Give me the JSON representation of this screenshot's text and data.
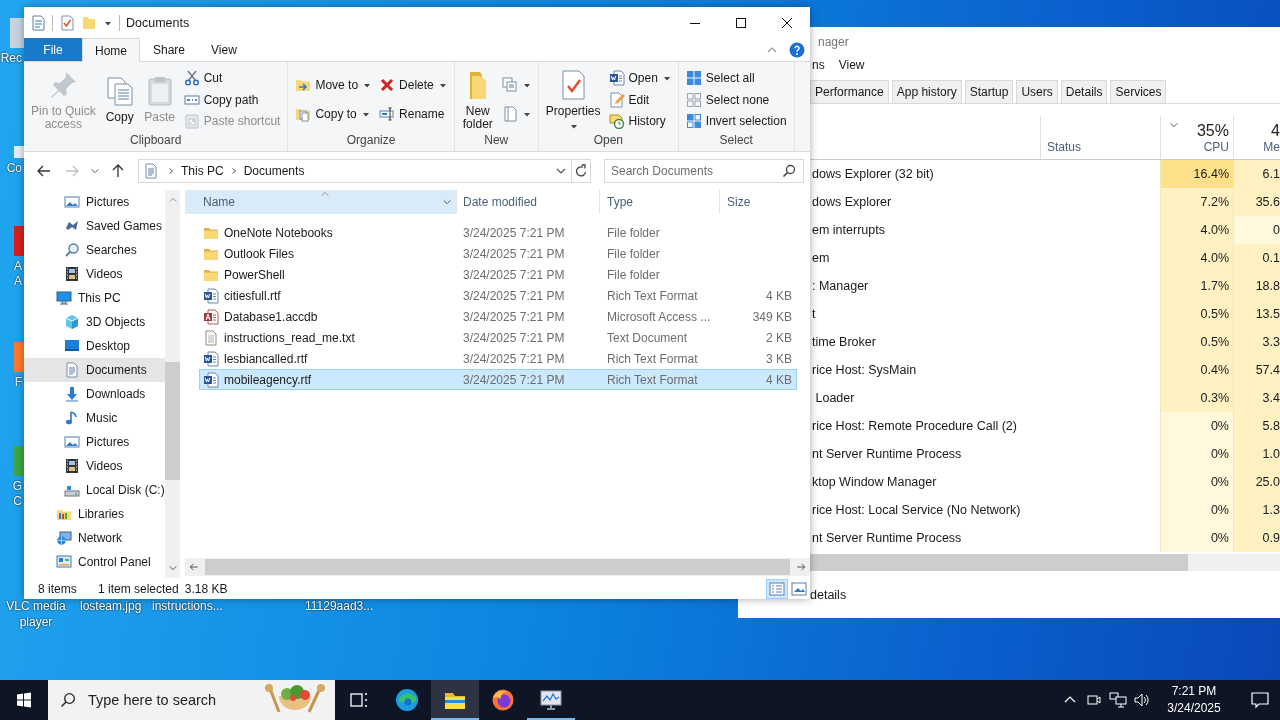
{
  "desktop": {
    "icons_left": [
      {
        "kind": "recycle",
        "lines": [
          "Rec"
        ]
      },
      {
        "kind": "shortcut",
        "lines": [
          "Co"
        ]
      },
      {
        "kind": "acrobat",
        "lines": [
          "A",
          "A"
        ]
      },
      {
        "kind": "firefox",
        "lines": [
          "F"
        ]
      },
      {
        "kind": "chrome",
        "lines": [
          "G",
          "C"
        ]
      }
    ],
    "icons_bottom": [
      {
        "lines": [
          "VLC media",
          "player"
        ]
      },
      {
        "lines": [
          "losteam.jpg"
        ]
      },
      {
        "lines": [
          "instructions..."
        ]
      },
      {
        "lines": [
          "11129aad3..."
        ]
      }
    ]
  },
  "task_manager": {
    "title": "nager",
    "menu": [
      "ns",
      "View"
    ],
    "tabs": [
      {
        "label": "Performance",
        "selected": false
      },
      {
        "label": "App history",
        "selected": false
      },
      {
        "label": "Startup",
        "selected": false
      },
      {
        "label": "Users",
        "selected": false
      },
      {
        "label": "Details",
        "selected": false
      },
      {
        "label": "Services",
        "selected": false
      }
    ],
    "columns": [
      {
        "label": "Status",
        "sorted": false
      },
      {
        "label": "CPU",
        "total": "35%",
        "sorted": true
      },
      {
        "label": "Me",
        "total": "4",
        "sorted": false
      }
    ],
    "rows": [
      {
        "name": "dows Explorer (32 bit)",
        "cpu": {
          "text": "16.4%",
          "color": "#ffe08a"
        },
        "mem": {
          "text": "6.1",
          "color": "#fff1c2"
        }
      },
      {
        "name": "dows Explorer",
        "cpu": {
          "text": "7.2%",
          "color": "#fff1c2"
        },
        "mem": {
          "text": "35.6",
          "color": "#fff1c2"
        }
      },
      {
        "name": "em interrupts",
        "cpu": {
          "text": "4.0%",
          "color": "#fff1c2"
        },
        "mem": {
          "text": "0",
          "color": "#fff8dc"
        }
      },
      {
        "name": "em",
        "cpu": {
          "text": "4.0%",
          "color": "#fff1c2"
        },
        "mem": {
          "text": "0.1",
          "color": "#fff1c2"
        }
      },
      {
        "name": ": Manager",
        "cpu": {
          "text": "1.7%",
          "color": "#fff1c2"
        },
        "mem": {
          "text": "18.8",
          "color": "#fff1c2"
        }
      },
      {
        "name": "t",
        "cpu": {
          "text": "0.5%",
          "color": "#fff1c2"
        },
        "mem": {
          "text": "13.5",
          "color": "#fff1c2"
        }
      },
      {
        "name": "time Broker",
        "cpu": {
          "text": "0.5%",
          "color": "#fff1c2"
        },
        "mem": {
          "text": "3.3",
          "color": "#fff1c2"
        }
      },
      {
        "name": "rice Host: SysMain",
        "cpu": {
          "text": "0.4%",
          "color": "#fff1c2"
        },
        "mem": {
          "text": "57.4",
          "color": "#fff1c2"
        }
      },
      {
        "name": " Loader",
        "cpu": {
          "text": "0.3%",
          "color": "#fff1c2"
        },
        "mem": {
          "text": "3.4",
          "color": "#fff1c2"
        }
      },
      {
        "name": "rice Host: Remote Procedure Call (2)",
        "cpu": {
          "text": "0%",
          "color": "#fff8dc"
        },
        "mem": {
          "text": "5.8",
          "color": "#fff1c2"
        }
      },
      {
        "name": "nt Server Runtime Process",
        "cpu": {
          "text": "0%",
          "color": "#fff8dc"
        },
        "mem": {
          "text": "1.0",
          "color": "#fff1c2"
        }
      },
      {
        "name": "ktop Window Manager",
        "cpu": {
          "text": "0%",
          "color": "#fff8dc"
        },
        "mem": {
          "text": "25.0",
          "color": "#fff1c2"
        }
      },
      {
        "name": "rice Host: Local Service (No Network)",
        "cpu": {
          "text": "0%",
          "color": "#fff8dc"
        },
        "mem": {
          "text": "1.3",
          "color": "#fff1c2"
        }
      },
      {
        "name": "nt Server Runtime Process",
        "cpu": {
          "text": "0%",
          "color": "#fff8dc"
        },
        "mem": {
          "text": "0.9",
          "color": "#fff1c2"
        }
      }
    ],
    "footer": "details"
  },
  "explorer": {
    "title": "Documents",
    "ribbon": {
      "tabs": [
        {
          "label": "File",
          "kind": "file",
          "selected": false
        },
        {
          "label": "Home",
          "kind": "tab",
          "selected": true
        },
        {
          "label": "Share",
          "kind": "tab",
          "selected": false
        },
        {
          "label": "View",
          "kind": "tab",
          "selected": false
        }
      ],
      "groups": [
        {
          "label": "Clipboard",
          "columns": [
            [
              {
                "label": "Pin to Quick\naccess",
                "kind": "pin",
                "large": true,
                "disabled": true,
                "dropdown": false
              }
            ],
            [
              {
                "label": "Copy",
                "kind": "copy",
                "large": true,
                "disabled": false,
                "dropdown": false
              }
            ],
            [
              {
                "label": "Paste",
                "kind": "paste",
                "large": true,
                "disabled": true,
                "dropdown": false
              }
            ],
            [
              {
                "label": "Cut",
                "kind": "cut",
                "large": false,
                "disabled": false,
                "dropdown": false
              },
              {
                "label": "Copy path",
                "kind": "copypath",
                "large": false,
                "disabled": false,
                "dropdown": false
              },
              {
                "label": "Paste shortcut",
                "kind": "pasteshortcut",
                "large": false,
                "disabled": true,
                "dropdown": false
              }
            ]
          ]
        },
        {
          "label": "Organize",
          "columns": [
            [
              {
                "label": "Move to",
                "kind": "moveto",
                "large": false,
                "disabled": false,
                "dropdown": true
              },
              {
                "label": "Copy to",
                "kind": "copyto",
                "large": false,
                "disabled": false,
                "dropdown": true
              }
            ],
            [
              {
                "label": "Delete",
                "kind": "delete",
                "large": false,
                "disabled": false,
                "dropdown": true
              },
              {
                "label": "Rename",
                "kind": "rename",
                "large": false,
                "disabled": false,
                "dropdown": false
              }
            ]
          ]
        },
        {
          "label": "New",
          "columns": [
            [
              {
                "label": "New\nfolder",
                "kind": "newfolder",
                "large": true,
                "disabled": false,
                "dropdown": false
              }
            ],
            [
              {
                "kind": "newitem",
                "large": false,
                "disabled": false,
                "dropdown": true
              },
              {
                "kind": "easyaccess",
                "large": false,
                "disabled": false,
                "dropdown": true
              }
            ]
          ]
        },
        {
          "label": "Open",
          "columns": [
            [
              {
                "label": "Properties",
                "kind": "properties",
                "large": true,
                "disabled": false,
                "dropdown": true
              }
            ],
            [
              {
                "label": "Open",
                "kind": "open",
                "large": false,
                "disabled": false,
                "dropdown": true
              },
              {
                "label": "Edit",
                "kind": "edit",
                "large": false,
                "disabled": false,
                "dropdown": false
              },
              {
                "label": "History",
                "kind": "history",
                "large": false,
                "disabled": false,
                "dropdown": false
              }
            ]
          ]
        },
        {
          "label": "Select",
          "columns": [
            [
              {
                "label": "Select all",
                "kind": "selectall",
                "large": false,
                "disabled": false,
                "dropdown": false
              },
              {
                "label": "Select none",
                "kind": "selectnone",
                "large": false,
                "disabled": false,
                "dropdown": false
              },
              {
                "label": "Invert selection",
                "kind": "invert",
                "large": false,
                "disabled": false,
                "dropdown": false
              }
            ]
          ]
        }
      ]
    },
    "navigation": {
      "back_disabled": false,
      "forward_disabled": true
    },
    "address": {
      "segments": [
        "This PC",
        "Documents"
      ]
    },
    "search": {
      "placeholder": "Search Documents"
    },
    "nav_pane": {
      "items": [
        {
          "children": [
            {
              "label": "Pictures",
              "kind": "pictures",
              "selected": false
            },
            {
              "label": "Saved Games",
              "kind": "games",
              "selected": false
            },
            {
              "label": "Searches",
              "kind": "search",
              "selected": false
            },
            {
              "label": "Videos",
              "kind": "videos",
              "selected": false
            }
          ]
        },
        {
          "label": "This PC",
          "kind": "pc",
          "selected": false,
          "children": [
            {
              "label": "3D Objects",
              "kind": "objects3d",
              "selected": false
            },
            {
              "label": "Desktop",
              "kind": "desktop",
              "selected": false
            },
            {
              "label": "Documents",
              "kind": "documents",
              "selected": true
            },
            {
              "label": "Downloads",
              "kind": "downloads",
              "selected": false
            },
            {
              "label": "Music",
              "kind": "music",
              "selected": false
            },
            {
              "label": "Pictures",
              "kind": "pictures",
              "selected": false
            },
            {
              "label": "Videos",
              "kind": "videos",
              "selected": false
            },
            {
              "label": "Local Disk (C:)",
              "kind": "disk",
              "selected": false
            }
          ]
        },
        {
          "label": "Libraries",
          "kind": "libraries",
          "selected": false
        },
        {
          "label": "Network",
          "kind": "network",
          "selected": false
        },
        {
          "label": "Control Panel",
          "kind": "controlpanel",
          "selected": false
        }
      ]
    },
    "file_list": {
      "columns": [
        {
          "label": "Name",
          "sorted": true
        },
        {
          "label": "Date modified",
          "sorted": false
        },
        {
          "label": "Type",
          "sorted": false
        },
        {
          "label": "Size",
          "sorted": false
        }
      ],
      "rows": [
        {
          "name": "OneNote Notebooks",
          "kind": "folder",
          "date": "3/24/2025 7:21 PM",
          "type": "File folder",
          "selected": false
        },
        {
          "name": "Outlook Files",
          "kind": "folder",
          "date": "3/24/2025 7:21 PM",
          "type": "File folder",
          "selected": false
        },
        {
          "name": "PowerShell",
          "kind": "folder",
          "date": "3/24/2025 7:21 PM",
          "type": "File folder",
          "selected": false
        },
        {
          "name": "citiesfull.rtf",
          "kind": "rtf",
          "date": "3/24/2025 7:21 PM",
          "type": "Rich Text Format",
          "size": "4 KB",
          "selected": false
        },
        {
          "name": "Database1.accdb",
          "kind": "access",
          "date": "3/24/2025 7:21 PM",
          "type": "Microsoft Access ...",
          "size": "349 KB",
          "selected": false
        },
        {
          "name": "instructions_read_me.txt",
          "kind": "txt",
          "date": "3/24/2025 7:21 PM",
          "type": "Text Document",
          "size": "2 KB",
          "selected": false
        },
        {
          "name": "lesbiancalled.rtf",
          "kind": "rtf",
          "date": "3/24/2025 7:21 PM",
          "type": "Rich Text Format",
          "size": "3 KB",
          "selected": false
        },
        {
          "name": "mobileagency.rtf",
          "kind": "rtf",
          "date": "3/24/2025 7:21 PM",
          "type": "Rich Text Format",
          "size": "4 KB",
          "selected": true
        }
      ]
    },
    "status_bar": {
      "item_count": "8 items",
      "selection": "1 item selected",
      "selection_size": "3.18 KB",
      "views": [
        {
          "kind": "details",
          "selected": true
        },
        {
          "kind": "large",
          "selected": false
        }
      ]
    }
  },
  "taskbar": {
    "search_placeholder": "Type here to search",
    "apps": [
      {
        "kind": "taskview",
        "running": false,
        "active": false
      },
      {
        "kind": "edge",
        "running": false,
        "active": false
      },
      {
        "kind": "explorer",
        "running": true,
        "active": true
      },
      {
        "kind": "firefox",
        "running": false,
        "active": false
      },
      {
        "kind": "taskmgr",
        "running": true,
        "active": false
      }
    ],
    "clock": {
      "time": "7:21 PM",
      "date": "3/24/2025"
    }
  }
}
